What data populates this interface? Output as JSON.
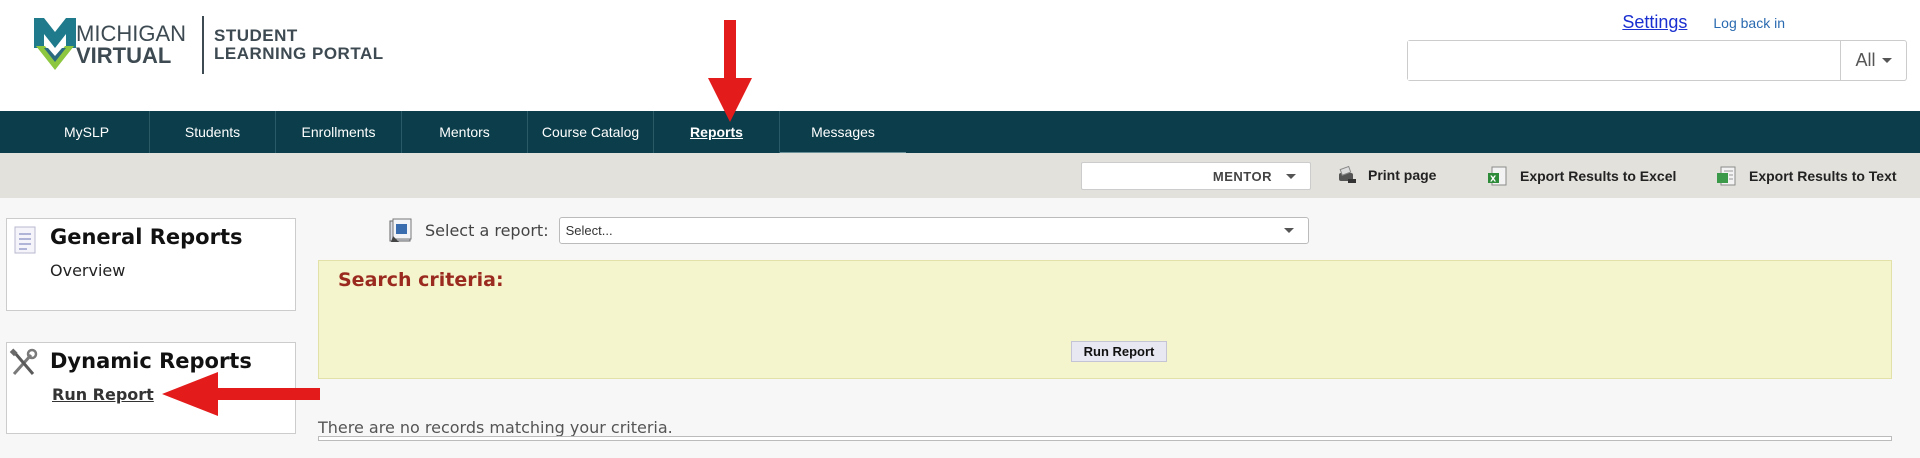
{
  "logo": {
    "line1": "MICHIGAN",
    "line2": "VIRTUAL",
    "portal_line1": "STUDENT",
    "portal_line2": "LEARNING PORTAL"
  },
  "top_links": {
    "settings": "Settings",
    "log_back_in": "Log back in"
  },
  "search": {
    "value": "",
    "placeholder": "",
    "scope": "All"
  },
  "nav": {
    "items": [
      {
        "label": "MySLP"
      },
      {
        "label": "Students"
      },
      {
        "label": "Enrollments"
      },
      {
        "label": "Mentors"
      },
      {
        "label": "Course Catalog"
      },
      {
        "label": "Reports"
      },
      {
        "label": "Messages"
      }
    ],
    "active": "Reports"
  },
  "toolbar": {
    "role": "MENTOR",
    "print": "Print page",
    "export_excel": "Export Results to Excel",
    "export_text": "Export Results to Text"
  },
  "sidebar": {
    "general": {
      "title": "General Reports",
      "link": "Overview"
    },
    "dynamic": {
      "title": "Dynamic Reports",
      "link": "Run Report"
    }
  },
  "report": {
    "select_label": "Select a report:",
    "select_value": "Select...",
    "criteria_title": "Search criteria:",
    "run_button": "Run Report",
    "no_records": "There are no records matching your criteria."
  },
  "colors": {
    "nav_bg": "#0b3d4a",
    "criteria_bg": "#f5f5cd",
    "criteria_title": "#9a2a1f",
    "arrow": "#e31b1b",
    "logo_teal": "#1f7a8c",
    "logo_green": "#8dc63f"
  }
}
